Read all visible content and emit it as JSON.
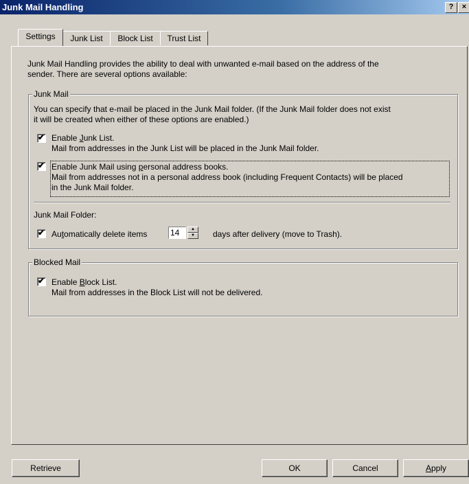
{
  "window": {
    "title": "Junk Mail Handling",
    "help_label": "?",
    "close_label": "×"
  },
  "tabs": [
    {
      "label": "Settings",
      "active": true
    },
    {
      "label": "Junk List",
      "active": false
    },
    {
      "label": "Block List",
      "active": false
    },
    {
      "label": "Trust List",
      "active": false
    }
  ],
  "intro": {
    "line1": "Junk Mail Handling provides the ability to deal with unwanted e-mail based on the address of the",
    "line2": "sender.  There are several options available:"
  },
  "junk_group": {
    "legend": "Junk Mail",
    "desc_line1": "You can specify that e-mail be placed in the Junk Mail folder.  (If the Junk Mail folder does not exist",
    "desc_line2": "it will be created when either of these options are enabled.)",
    "enable_junk_list": {
      "label_pre": "Enable ",
      "label_key": "J",
      "label_post": "unk List.",
      "checked": true,
      "desc": "Mail from addresses in the Junk List will be placed in the Junk Mail folder."
    },
    "enable_pab": {
      "label_pre": "Enable Junk Mail using ",
      "label_key": "p",
      "label_post": "ersonal address books.",
      "checked": true,
      "desc_line1": "Mail from addresses not in a personal address book (including Frequent Contacts) will be placed",
      "desc_line2": "in the Junk Mail folder."
    },
    "folder_label": "Junk Mail Folder:",
    "auto_delete": {
      "label_pre": "Au",
      "label_key": "t",
      "label_post": "omatically delete items",
      "checked": true,
      "days_value": "14",
      "suffix": "days after delivery (move to Trash)."
    }
  },
  "blocked_group": {
    "legend": "Blocked Mail",
    "enable_block": {
      "label_pre": "Enable ",
      "label_key": "B",
      "label_post": "lock List.",
      "checked": true,
      "desc": "Mail from addresses in the Block List will not be delivered."
    }
  },
  "buttons": {
    "retrieve": "Retrieve",
    "ok": "OK",
    "cancel": "Cancel",
    "apply_key": "A",
    "apply_rest": "pply"
  },
  "check_glyph": "✔"
}
